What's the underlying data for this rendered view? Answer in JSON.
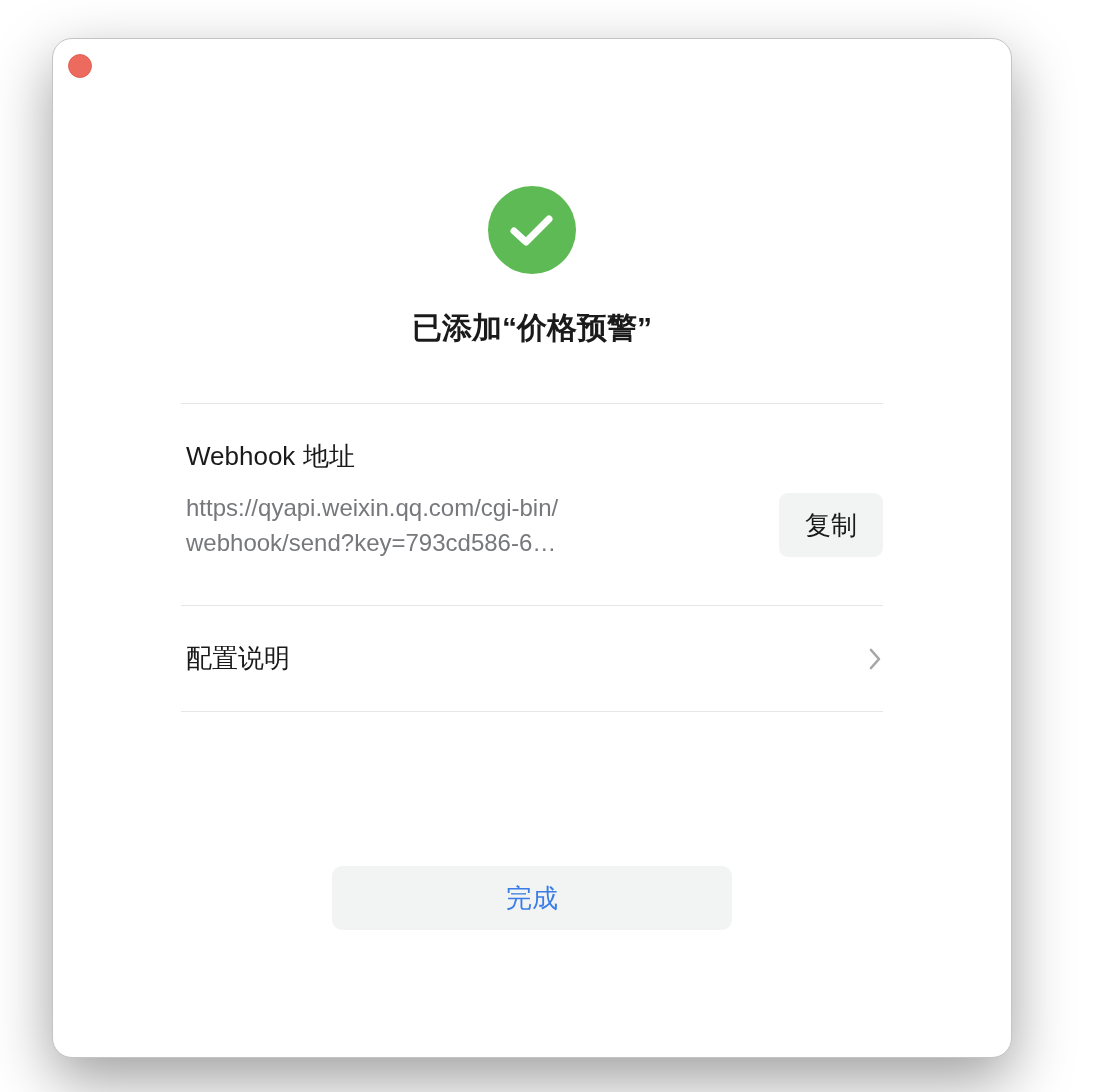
{
  "dialog": {
    "title": "已添加“价格预警”"
  },
  "webhook": {
    "label": "Webhook 地址",
    "url_lines": [
      "https://qyapi.weixin.qq.com/cgi-bin/",
      "webhook/send?key=793cd586-6…"
    ],
    "copy_button": "复制"
  },
  "config_link": {
    "label": "配置说明"
  },
  "done_button": "完成"
}
